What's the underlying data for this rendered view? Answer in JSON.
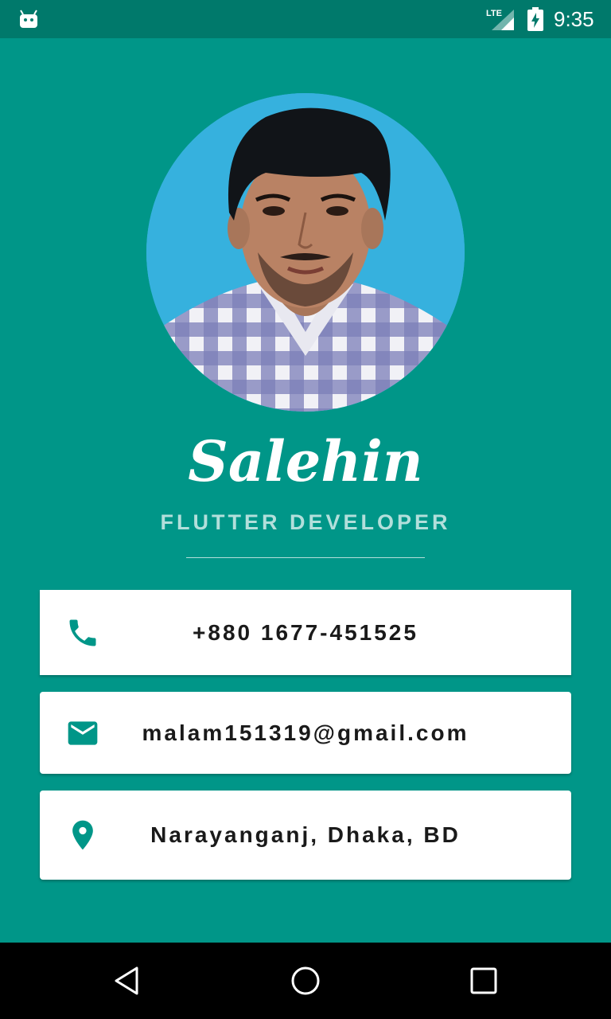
{
  "status_bar": {
    "time": "9:35",
    "network": "LTE",
    "icons": [
      "android-debug-icon",
      "lte-signal-icon",
      "battery-charging-icon"
    ]
  },
  "profile": {
    "name": "Salehin",
    "title": "FLUTTER DEVELOPER"
  },
  "contacts": {
    "phone": {
      "icon": "phone-icon",
      "value": "+880 1677-451525"
    },
    "email": {
      "icon": "email-icon",
      "value": "malam151319@gmail.com"
    },
    "location": {
      "icon": "location-pin-icon",
      "value": "Narayanganj, Dhaka, BD"
    }
  },
  "nav_bar": {
    "buttons": [
      "back-icon",
      "home-icon",
      "recents-icon"
    ]
  },
  "colors": {
    "background": "#009688",
    "status_bar": "#00796b",
    "subtitle": "#b2dfdb",
    "card": "#ffffff",
    "icon": "#009688",
    "text": "#1a1a1a"
  }
}
